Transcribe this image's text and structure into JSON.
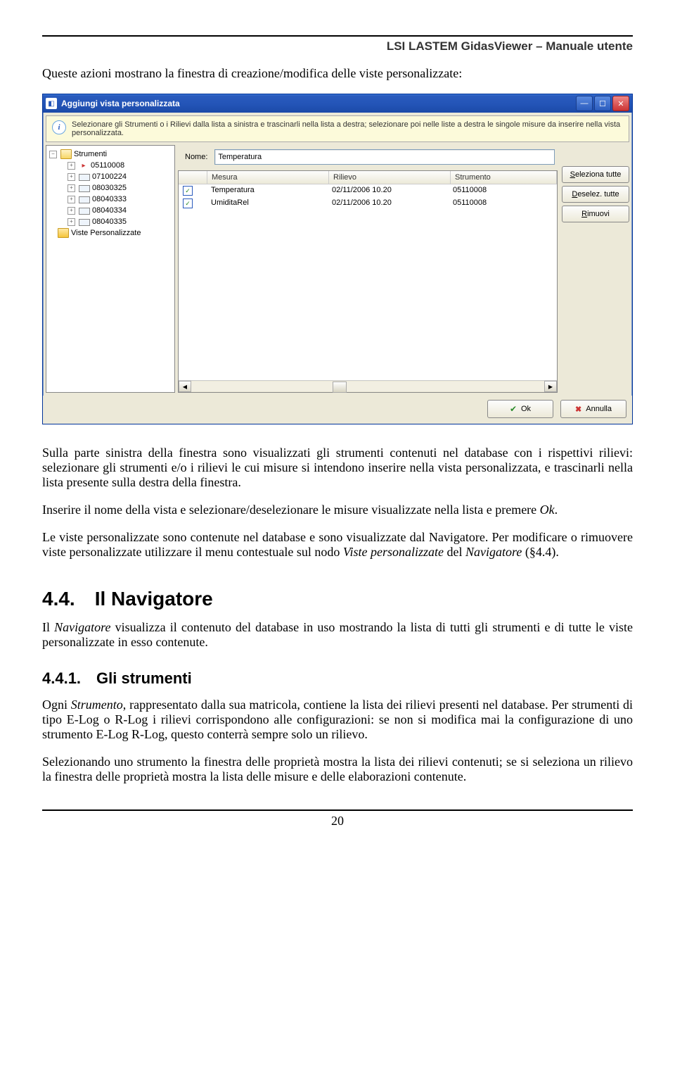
{
  "header": "LSI LASTEM GidasViewer – Manuale utente",
  "intro": "Queste azioni mostrano la finestra di creazione/modifica delle viste personalizzate:",
  "win": {
    "title": "Aggiungi vista personalizzata",
    "info": "Selezionare gli Strumenti o i Rilievi dalla lista a sinistra e trascinarli nella lista a destra; selezionare poi nelle liste a destra le singole misure da inserire nella vista personalizzata.",
    "tree": {
      "root": "Strumenti",
      "items": [
        "05110008",
        "07100224",
        "08030325",
        "08040333",
        "08040334",
        "08040335"
      ],
      "custom": "Viste Personalizzate"
    },
    "nome_label": "Nome:",
    "nome_value": "Temperatura",
    "cols": {
      "m": "Mesura",
      "r": "Rilievo",
      "s": "Strumento"
    },
    "rows": [
      {
        "m": "Temperatura",
        "r": "02/11/2006 10.20",
        "s": "05110008"
      },
      {
        "m": "UmiditaRel",
        "r": "02/11/2006 10.20",
        "s": "05110008"
      }
    ],
    "btn_sel": "Seleziona tutte",
    "btn_desel": "Deselez. tutte",
    "btn_rimuovi": "Rimuovi",
    "btn_ok": "Ok",
    "btn_annulla": "Annulla"
  },
  "p1": "Sulla parte sinistra della finestra sono visualizzati gli strumenti contenuti nel database con i rispettivi rilievi: selezionare gli strumenti e/o i rilievi le cui misure si intendono inserire nella vista personalizzata, e trascinarli nella lista presente sulla destra della finestra.",
  "p2a": "Inserire il nome della vista e selezionare/deselezionare le misure visualizzate nella lista e premere ",
  "p2b": "Ok",
  "p2c": ".",
  "p3a": "Le viste personalizzate sono contenute nel database e sono visualizzate dal Navigatore. Per modificare o rimuovere viste personalizzate utilizzare il menu contestuale sul nodo ",
  "p3b": "Viste personalizzate",
  "p3c": " del ",
  "p3d": "Navigatore",
  "p3e": " (§4.4).",
  "sec": {
    "num": "4.4.",
    "title": "Il Navigatore"
  },
  "p4a": "Il ",
  "p4b": "Navigatore",
  "p4c": " visualizza il contenuto del database in uso mostrando la lista di tutti gli strumenti e di tutte le viste personalizzate in esso contenute.",
  "sub": {
    "num": "4.4.1.",
    "title": "Gli strumenti"
  },
  "p5a": "Ogni ",
  "p5b": "Strumento",
  "p5c": ", rappresentato dalla sua matricola, contiene la lista dei rilievi presenti nel database. Per strumenti di tipo E-Log o R-Log i rilievi corrispondono alle configurazioni: se non si modifica mai la configurazione di uno strumento E-Log R-Log, questo conterrà sempre solo un rilievo.",
  "p6": "Selezionando uno strumento la finestra delle proprietà mostra la lista dei rilievi contenuti; se si seleziona un rilievo la finestra delle proprietà mostra la lista delle misure e delle elaborazioni contenute.",
  "page_num": "20"
}
